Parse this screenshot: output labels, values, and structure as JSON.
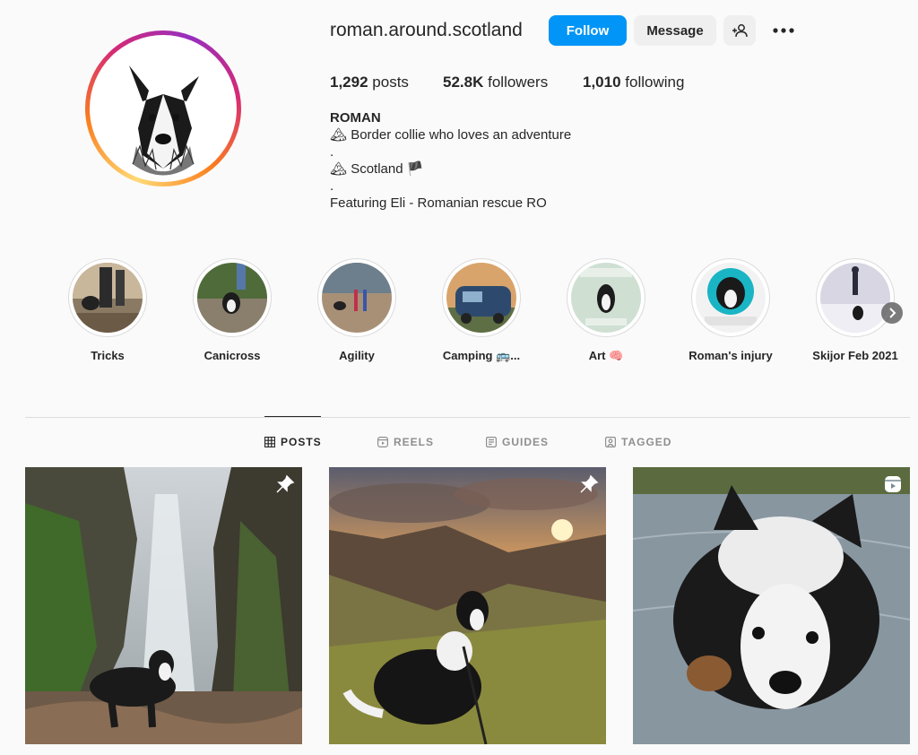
{
  "profile": {
    "username": "roman.around.scotland",
    "follow_label": "Follow",
    "message_label": "Message",
    "posts_count": "1,292",
    "posts_label": "posts",
    "followers_count": "52.8K",
    "followers_label": "followers",
    "following_count": "1,010",
    "following_label": "following",
    "name": "ROMAN",
    "bio_lines": [
      "🏔 Border collie who loves an adventure",
      ".",
      "🏔 Scotland 🏴",
      ".",
      "Featuring Eli - Romanian rescue RO"
    ]
  },
  "highlights": [
    {
      "label": "Tricks"
    },
    {
      "label": "Canicross"
    },
    {
      "label": "Agility"
    },
    {
      "label": "Camping 🚌..."
    },
    {
      "label": "Art 🧠"
    },
    {
      "label": "Roman's injury"
    },
    {
      "label": "Skijor Feb 2021"
    }
  ],
  "tabs": [
    {
      "label": "POSTS",
      "icon": "grid-icon",
      "active": true
    },
    {
      "label": "REELS",
      "icon": "reels-icon",
      "active": false
    },
    {
      "label": "GUIDES",
      "icon": "guides-icon",
      "active": false
    },
    {
      "label": "TAGGED",
      "icon": "tagged-icon",
      "active": false
    }
  ],
  "posts": [
    {
      "badge": "pin-icon"
    },
    {
      "badge": "pin-icon"
    },
    {
      "badge": "reel-icon"
    }
  ],
  "colors": {
    "accent": "#0095f6",
    "background": "#fafafa",
    "text": "#262626",
    "muted": "#8e8e8e"
  }
}
